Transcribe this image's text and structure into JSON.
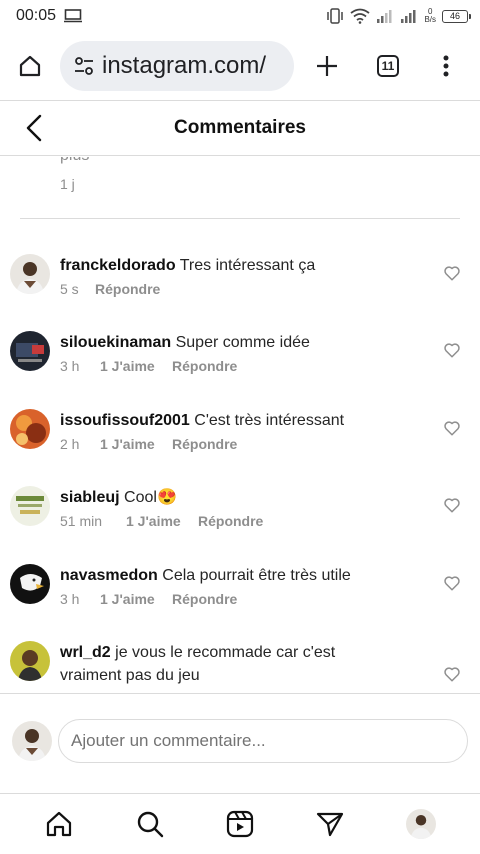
{
  "status_bar": {
    "time": "00:05",
    "net_speed_value": "0",
    "net_speed_unit": "B/s",
    "battery": "46"
  },
  "browser": {
    "url": "instagram.com/",
    "tab_count": "11"
  },
  "header": {
    "title": "Commentaires"
  },
  "caption": {
    "tail": "plus",
    "time": "1 j"
  },
  "comments": [
    {
      "username": "franckeldorado",
      "text": "Tres intéressant ça",
      "time": "5 s",
      "likes": "",
      "reply": "Répondre"
    },
    {
      "username": "silouekinaman",
      "text": "Super comme idée",
      "time": "3 h",
      "likes": "1 J'aime",
      "reply": "Répondre"
    },
    {
      "username": "issoufissouf2001",
      "text": "C'est très intéressant",
      "time": "2 h",
      "likes": "1 J'aime",
      "reply": "Répondre"
    },
    {
      "username": "siableuj",
      "text": "Cool😍",
      "time": "51 min",
      "likes": "1 J'aime",
      "reply": "Répondre"
    },
    {
      "username": "navasmedon",
      "text": "Cela pourrait être très utile",
      "time": "3 h",
      "likes": "1 J'aime",
      "reply": "Répondre"
    },
    {
      "username": "wrl_d2",
      "text": "je vous le recommade car c'est vraiment pas du jeu",
      "time": "",
      "likes": "",
      "reply": ""
    }
  ],
  "composer": {
    "placeholder": "Ajouter un commentaire..."
  },
  "nav": [
    "home-icon",
    "search-icon",
    "reels-icon",
    "direct-icon",
    "profile-avatar"
  ],
  "colors": {
    "text": "#262626",
    "secondary": "#8e8e8e",
    "border": "#dbdbdb",
    "url_bg": "#eceef2"
  }
}
